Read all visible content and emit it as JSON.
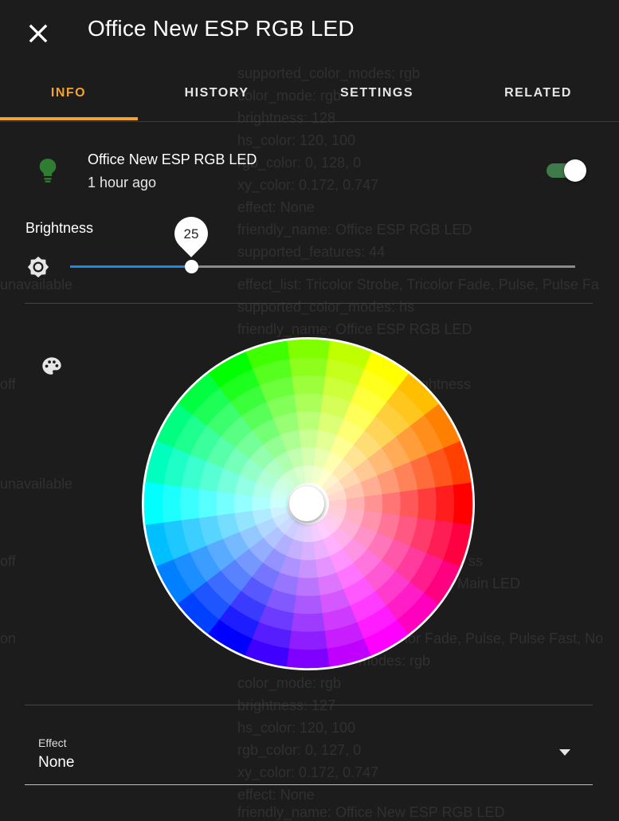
{
  "dialog": {
    "title": "Office New ESP RGB LED",
    "close_icon": "close-icon"
  },
  "tabs": [
    {
      "label": "INFO",
      "active": true
    },
    {
      "label": "HISTORY",
      "active": false
    },
    {
      "label": "SETTINGS",
      "active": false
    },
    {
      "label": "RELATED",
      "active": false
    }
  ],
  "entity": {
    "name": "Office New ESP RGB LED",
    "last_changed": "1 hour ago",
    "icon": "lightbulb-icon",
    "state_on": true
  },
  "brightness": {
    "label": "Brightness",
    "value": "25",
    "value_fraction": 0.24,
    "icon": "brightness-icon"
  },
  "color": {
    "icon": "palette-icon"
  },
  "effect": {
    "label": "Effect",
    "value": "None"
  },
  "background_text": [
    "supported_color_modes: rgb",
    "color_mode: rgb",
    "brightness: 128",
    "hs_color: 120, 100",
    "rgb_color: 0, 128, 0",
    "xy_color: 0.172, 0.747",
    "effect: None",
    "friendly_name: Office ESP RGB LED",
    "supported_features: 44",
    "effect_list: Tricolor Strobe, Tricolor Fade, Pulse, Pulse Fa",
    "supported_color_modes: hs",
    "friendly_name: Office ESP RGB LED",
    "unavailable",
    "off",
    "unavailable",
    "off",
    "on",
    "ghtness",
    "ss",
    "Main LED",
    "lor Fade, Pulse, Pulse Fast, No",
    "modes: rgb",
    "color_mode: rgb",
    "brightness: 127",
    "hs_color: 120, 100",
    "rgb_color: 0, 127, 0",
    "xy_color: 0.172, 0.747",
    "effect: None",
    "friendly_name: Office New ESP RGB LED"
  ],
  "colors": {
    "accent": "#f0a32f",
    "slider": "#1e88e5",
    "toggle_track": "#3f7a4a",
    "bulb": "#2e7d32",
    "background": "#1c1c1c"
  }
}
